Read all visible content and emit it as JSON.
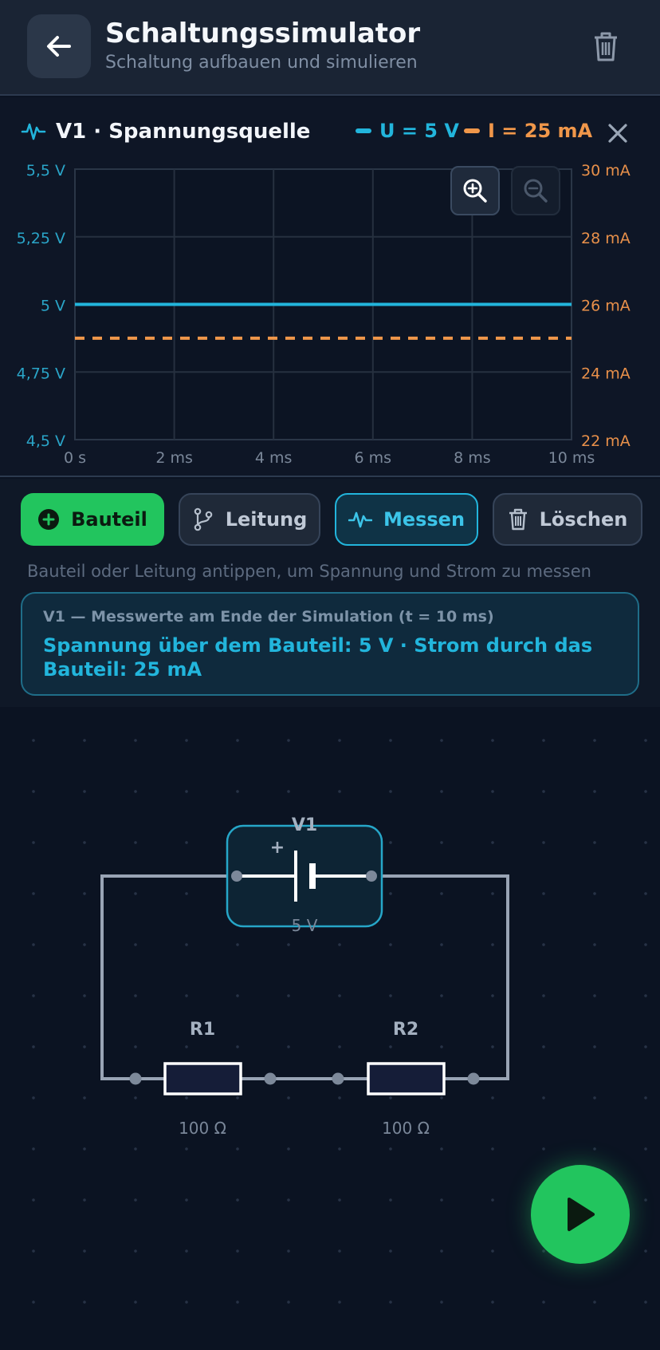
{
  "header": {
    "title": "Schaltungssimulator",
    "subtitle": "Schaltung aufbauen und simulieren"
  },
  "chart_panel": {
    "component_name": "V1 · Spannungsquelle",
    "legend_voltage": "U = 5 V",
    "legend_current": "I = 25 mA"
  },
  "chart_data": {
    "type": "line",
    "title": "",
    "x": [
      0,
      2,
      4,
      6,
      8,
      10
    ],
    "x_unit": "ms",
    "xlim": [
      0,
      10
    ],
    "x_tick_labels": [
      "0 s",
      "2 ms",
      "4 ms",
      "6 ms",
      "8 ms",
      "10 ms"
    ],
    "y_left_lim": [
      4.5,
      5.5
    ],
    "y_left_tick_labels": [
      "5,5 V",
      "5,25 V",
      "5 V",
      "4,75 V",
      "4,5 V"
    ],
    "y_right_lim": [
      22,
      30
    ],
    "y_right_tick_labels": [
      "30 mA",
      "28 mA",
      "26 mA",
      "24 mA",
      "22 mA"
    ],
    "grid": true,
    "series": [
      {
        "name": "U = 5 V",
        "axis": "left",
        "style": "solid",
        "color": "#22b5dc",
        "values": [
          5,
          5,
          5,
          5,
          5,
          5
        ]
      },
      {
        "name": "I = 25 mA",
        "axis": "right",
        "style": "dashed",
        "color": "#f0974a",
        "values": [
          25,
          25,
          25,
          25,
          25,
          25
        ]
      }
    ]
  },
  "toolbar": {
    "add_label": "Bauteil",
    "wire_label": "Leitung",
    "measure_label": "Messen",
    "delete_label": "Löschen"
  },
  "hint": "Bauteil oder Leitung antippen, um Spannung und Strom zu messen",
  "measurement": {
    "caption": "V1 — Messwerte am Ende der Simulation (t = 10 ms)",
    "values": "Spannung über dem Bauteil: 5 V   ·   Strom durch das Bauteil: 25 mA"
  },
  "circuit": {
    "source": {
      "label": "V1",
      "polarity": "+",
      "value": "5 V"
    },
    "resistors": [
      {
        "label": "R1",
        "value": "100 Ω"
      },
      {
        "label": "R2",
        "value": "100 Ω"
      }
    ]
  },
  "colors": {
    "accent_voltage": "#22b5dc",
    "accent_current": "#f0974a",
    "primary_green": "#22c55e"
  }
}
